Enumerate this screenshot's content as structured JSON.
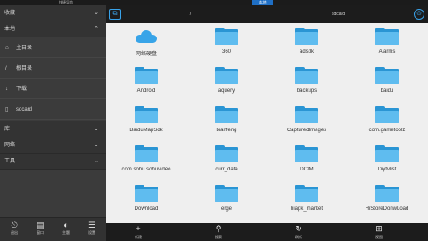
{
  "topbar": {
    "left_tab": "快捷导航",
    "right_tab": "本地"
  },
  "sidebar": {
    "sections": [
      {
        "label": "本地",
        "icon": "chevron-up-icon"
      },
      {
        "label": "库",
        "icon": "chevron-down-icon"
      },
      {
        "label": "网络",
        "icon": "chevron-down-icon"
      },
      {
        "label": "工具",
        "icon": "chevron-down-icon"
      }
    ],
    "top_section": {
      "label": "收藏",
      "icon": "chevron-down-icon"
    },
    "items": [
      {
        "label": "主目录",
        "icon": "home-icon"
      },
      {
        "label": "根目录",
        "icon": "slash-icon"
      },
      {
        "label": "下载",
        "icon": "download-icon"
      },
      {
        "label": "sdcard",
        "icon": "sdcard-icon"
      }
    ],
    "bottom_buttons": [
      {
        "label": "退出",
        "icon": "exit-icon"
      },
      {
        "label": "窗口",
        "icon": "window-icon"
      },
      {
        "label": "主题",
        "icon": "theme-icon"
      },
      {
        "label": "设置",
        "icon": "settings-icon"
      }
    ]
  },
  "pathbar": {
    "root": "/",
    "current": "sdcard"
  },
  "files": [
    {
      "name": "网络硬盘",
      "type": "cloud"
    },
    {
      "name": "360",
      "type": "folder"
    },
    {
      "name": "adsdk",
      "type": "folder"
    },
    {
      "name": "Alarms",
      "type": "folder"
    },
    {
      "name": "Android",
      "type": "folder"
    },
    {
      "name": "aquery",
      "type": "folder"
    },
    {
      "name": "backups",
      "type": "folder"
    },
    {
      "name": "baidu",
      "type": "folder"
    },
    {
      "name": "BaiduMapSdk",
      "type": "folder"
    },
    {
      "name": "bianfeng",
      "type": "folder"
    },
    {
      "name": "CapturedImages",
      "type": "folder"
    },
    {
      "name": "com.gametoolz",
      "type": "folder"
    },
    {
      "name": "com.sohu.sohuvideo",
      "type": "folder"
    },
    {
      "name": "curr_data",
      "type": "folder"
    },
    {
      "name": "DCIM",
      "type": "folder"
    },
    {
      "name": "Diytvlist",
      "type": "folder"
    },
    {
      "name": "Download",
      "type": "folder"
    },
    {
      "name": "erge",
      "type": "folder"
    },
    {
      "name": "hiapk_market",
      "type": "folder"
    },
    {
      "name": "HiStoreDonwLoad",
      "type": "folder"
    }
  ],
  "actionbar": [
    {
      "label": "新建",
      "icon": "plus-icon"
    },
    {
      "label": "搜索",
      "icon": "search-icon"
    },
    {
      "label": "刷新",
      "icon": "refresh-icon"
    },
    {
      "label": "视图",
      "icon": "grid-view-icon"
    }
  ],
  "colors": {
    "accent": "#1f6fc5",
    "folder_back": "#2a95d4",
    "folder_front": "#5fbcef",
    "sidebar_bg": "#3b3b3b",
    "content_bg": "#efefef"
  }
}
